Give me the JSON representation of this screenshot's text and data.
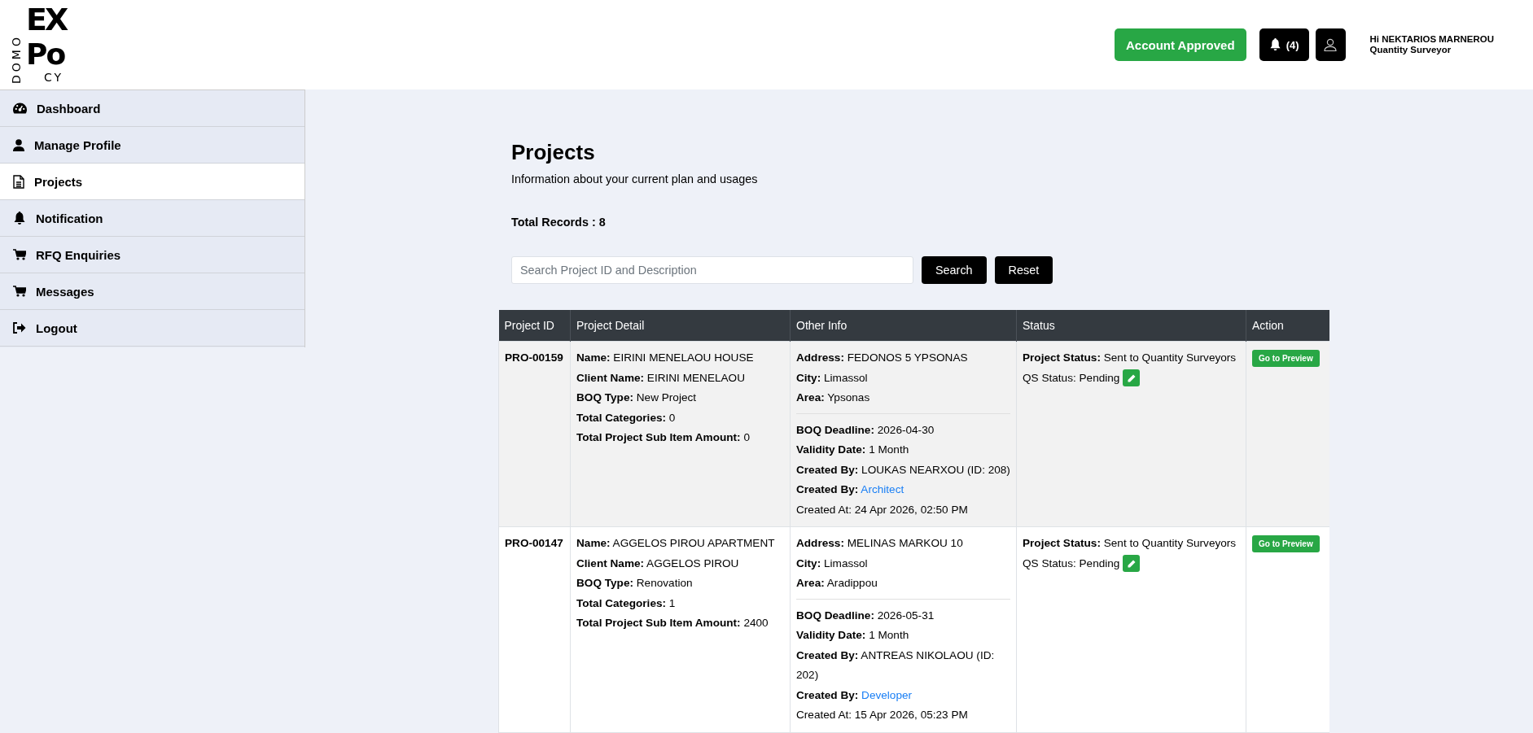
{
  "logo": {
    "side": "DOMO",
    "top": "EX",
    "middle": "Po",
    "bottom": "CY"
  },
  "header": {
    "status_button": "Account Approved",
    "notifications_count": "(4)",
    "greeting": "Hi NEKTARIOS MARNEROU",
    "role": "Quantity Surveyor"
  },
  "sidebar": {
    "items": [
      {
        "label": "Dashboard",
        "selected": false
      },
      {
        "label": "Manage Profile",
        "selected": false
      },
      {
        "label": "Projects",
        "selected": true
      },
      {
        "label": "Notification",
        "selected": false
      },
      {
        "label": "RFQ Enquiries",
        "selected": false
      },
      {
        "label": "Messages",
        "selected": false
      },
      {
        "label": "Logout",
        "selected": false
      }
    ]
  },
  "page": {
    "title": "Projects",
    "subtitle": "Information about your current plan and usages",
    "total_records": "Total Records : 8"
  },
  "search": {
    "placeholder": "Search Project ID and Description",
    "search_button": "Search",
    "reset_button": "Reset"
  },
  "table": {
    "columns": [
      "Project ID",
      "Project Detail",
      "Other Info",
      "Status",
      "Action"
    ],
    "rows": [
      {
        "project_id": "PRO-00159",
        "detail": [
          {
            "label": "Name:",
            "value": "EIRINI MENELAOU HOUSE"
          },
          {
            "label": "Client Name:",
            "value": "EIRINI MENELAOU"
          },
          {
            "label": "BOQ Type:",
            "value": "New Project"
          },
          {
            "label": "Total Categories:",
            "value": "0"
          },
          {
            "label": "Total Project Sub Item Amount:",
            "value": "0"
          }
        ],
        "location": [
          {
            "label": "Address:",
            "value": "FEDONOS 5 YPSONAS"
          },
          {
            "label": "City:",
            "value": "Limassol"
          },
          {
            "label": "Area:",
            "value": "Ypsonas"
          }
        ],
        "info": [
          {
            "kind": "field",
            "label": "BOQ Deadline:",
            "value": "2026-04-30"
          },
          {
            "kind": "field",
            "label": "Validity Date:",
            "value": "1 Month"
          },
          {
            "kind": "field",
            "label": "Created By:",
            "value": "LOUKAS NEARXOU (ID: 208)"
          },
          {
            "kind": "link",
            "label": "Created By:",
            "value": "Architect"
          },
          {
            "kind": "text",
            "value": "Created At: 24 Apr 2026, 02:50 PM"
          }
        ],
        "project_status_label": "Project Status:",
        "project_status": "Sent to Quantity Surveyors",
        "qs_status": "QS Status: Pending",
        "action": "Go to Preview"
      },
      {
        "project_id": "PRO-00147",
        "detail": [
          {
            "label": "Name:",
            "value": "AGGELOS PIROU APARTMENT"
          },
          {
            "label": "Client Name:",
            "value": "AGGELOS PIROU"
          },
          {
            "label": "BOQ Type:",
            "value": "Renovation"
          },
          {
            "label": "Total Categories:",
            "value": "1"
          },
          {
            "label": "Total Project Sub Item Amount:",
            "value": "2400"
          }
        ],
        "location": [
          {
            "label": "Address:",
            "value": "MELINAS MARKOU 10"
          },
          {
            "label": "City:",
            "value": "Limassol"
          },
          {
            "label": "Area:",
            "value": "Aradippou"
          }
        ],
        "info": [
          {
            "kind": "field",
            "label": "BOQ Deadline:",
            "value": "2026-05-31"
          },
          {
            "kind": "field",
            "label": "Validity Date:",
            "value": "1 Month"
          },
          {
            "kind": "field",
            "label": "Created By:",
            "value": "ANTREAS NIKOLAOU (ID: 202)"
          },
          {
            "kind": "link",
            "label": "Created By:",
            "value": "Developer"
          },
          {
            "kind": "text",
            "value": "Created At: 15 Apr 2026, 05:23 PM"
          }
        ],
        "project_status_label": "Project Status:",
        "project_status": "Sent to Quantity Surveyors",
        "qs_status": "QS Status: Pending",
        "action": "Go to Preview"
      }
    ]
  }
}
